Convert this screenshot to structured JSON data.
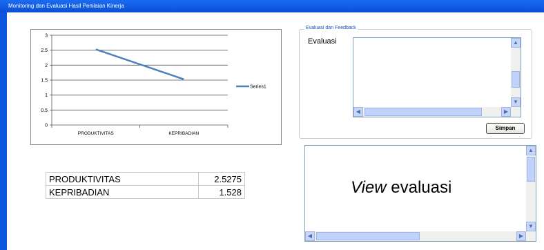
{
  "window": {
    "title": "Monitoring dan Evaluasi Hasil Penilaian Kinerja"
  },
  "chart_data": {
    "type": "line",
    "categories": [
      "PRODUKTIVITAS",
      "KEPRIBADIAN"
    ],
    "series": [
      {
        "name": "Series1",
        "values": [
          2.5275,
          1.528
        ],
        "color": "#4f81bd"
      }
    ],
    "ylim": [
      0,
      3
    ],
    "yticks": [
      "0",
      "0.5",
      "1",
      "1.5",
      "2",
      "2.5",
      "3"
    ],
    "grid": true,
    "legend_position": "right"
  },
  "table": {
    "rows": [
      {
        "label": "PRODUKTIVITAS",
        "value": "2.5275"
      },
      {
        "label": "KEPRIBADIAN",
        "value": "1.528"
      }
    ]
  },
  "evaluation": {
    "group_title": "Evaluasi dan Feedback",
    "label": "Evaluasi",
    "text": "",
    "save_label": "Simpan"
  },
  "view": {
    "italic": "View",
    "rest": " evaluasi"
  }
}
